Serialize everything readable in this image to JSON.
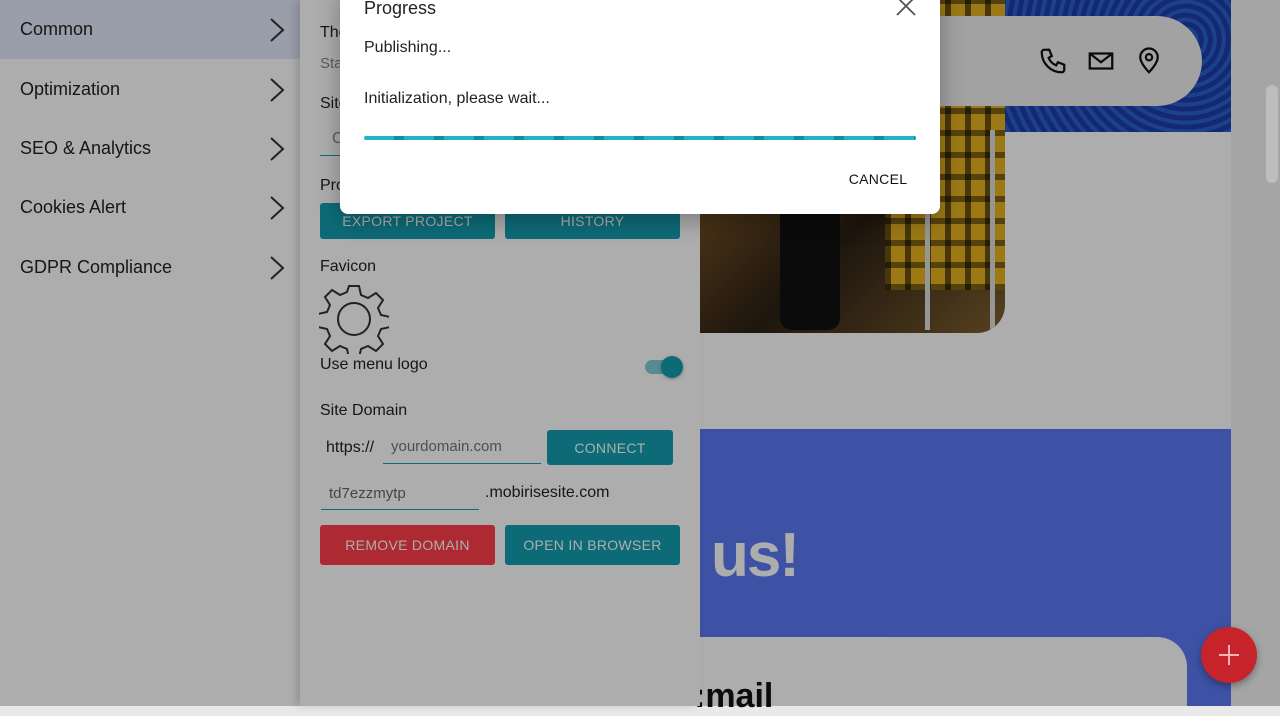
{
  "colors": {
    "accent": "#149eb0",
    "danger": "#ff3e4a",
    "sidebar_active": "#e3e8fb",
    "cta_blue": "#5b79f4",
    "fab": "#c7232b"
  },
  "sidebar": {
    "items": [
      {
        "label": "Common",
        "icon": "chevron-right-icon",
        "active": true
      },
      {
        "label": "Optimization",
        "icon": "chevron-right-icon"
      },
      {
        "label": "SEO & Analytics",
        "icon": "chevron-right-icon"
      },
      {
        "label": "Cookies Alert",
        "icon": "chevron-right-icon"
      },
      {
        "label": "GDPR Compliance",
        "icon": "chevron-right-icon"
      }
    ]
  },
  "panel": {
    "partial_label_1": "The",
    "partial_label_2": "Sta",
    "partial_label_3": "Site",
    "partial_label_4": "Pro",
    "partial_input": "C",
    "export_button": "EXPORT PROJECT",
    "history_button": "HISTORY",
    "favicon_label": "Favicon",
    "favicon_icon": "gear-icon",
    "use_menu_logo_label": "Use menu logo",
    "use_menu_logo_on": true,
    "site_domain_label": "Site Domain",
    "https_prefix": "https://",
    "domain_placeholder": "yourdomain.com",
    "connect_button": "CONNECT",
    "subdomain_value": "td7ezzmytp",
    "subdomain_suffix": ".mobirisesite.com",
    "remove_domain_button": "REMOVE DOMAIN",
    "open_browser_button": "OPEN IN BROWSER"
  },
  "site_preview": {
    "contact_icons": [
      "phone-icon",
      "mail-icon",
      "location-icon"
    ],
    "headline_fragment": "us!",
    "email_fragment": ":mail"
  },
  "dialog": {
    "title": "Progress",
    "status": "Publishing...",
    "message": "Initialization, please wait...",
    "cancel_button": "CANCEL",
    "close_icon": "close-icon"
  },
  "fab": {
    "icon": "plus-icon"
  }
}
